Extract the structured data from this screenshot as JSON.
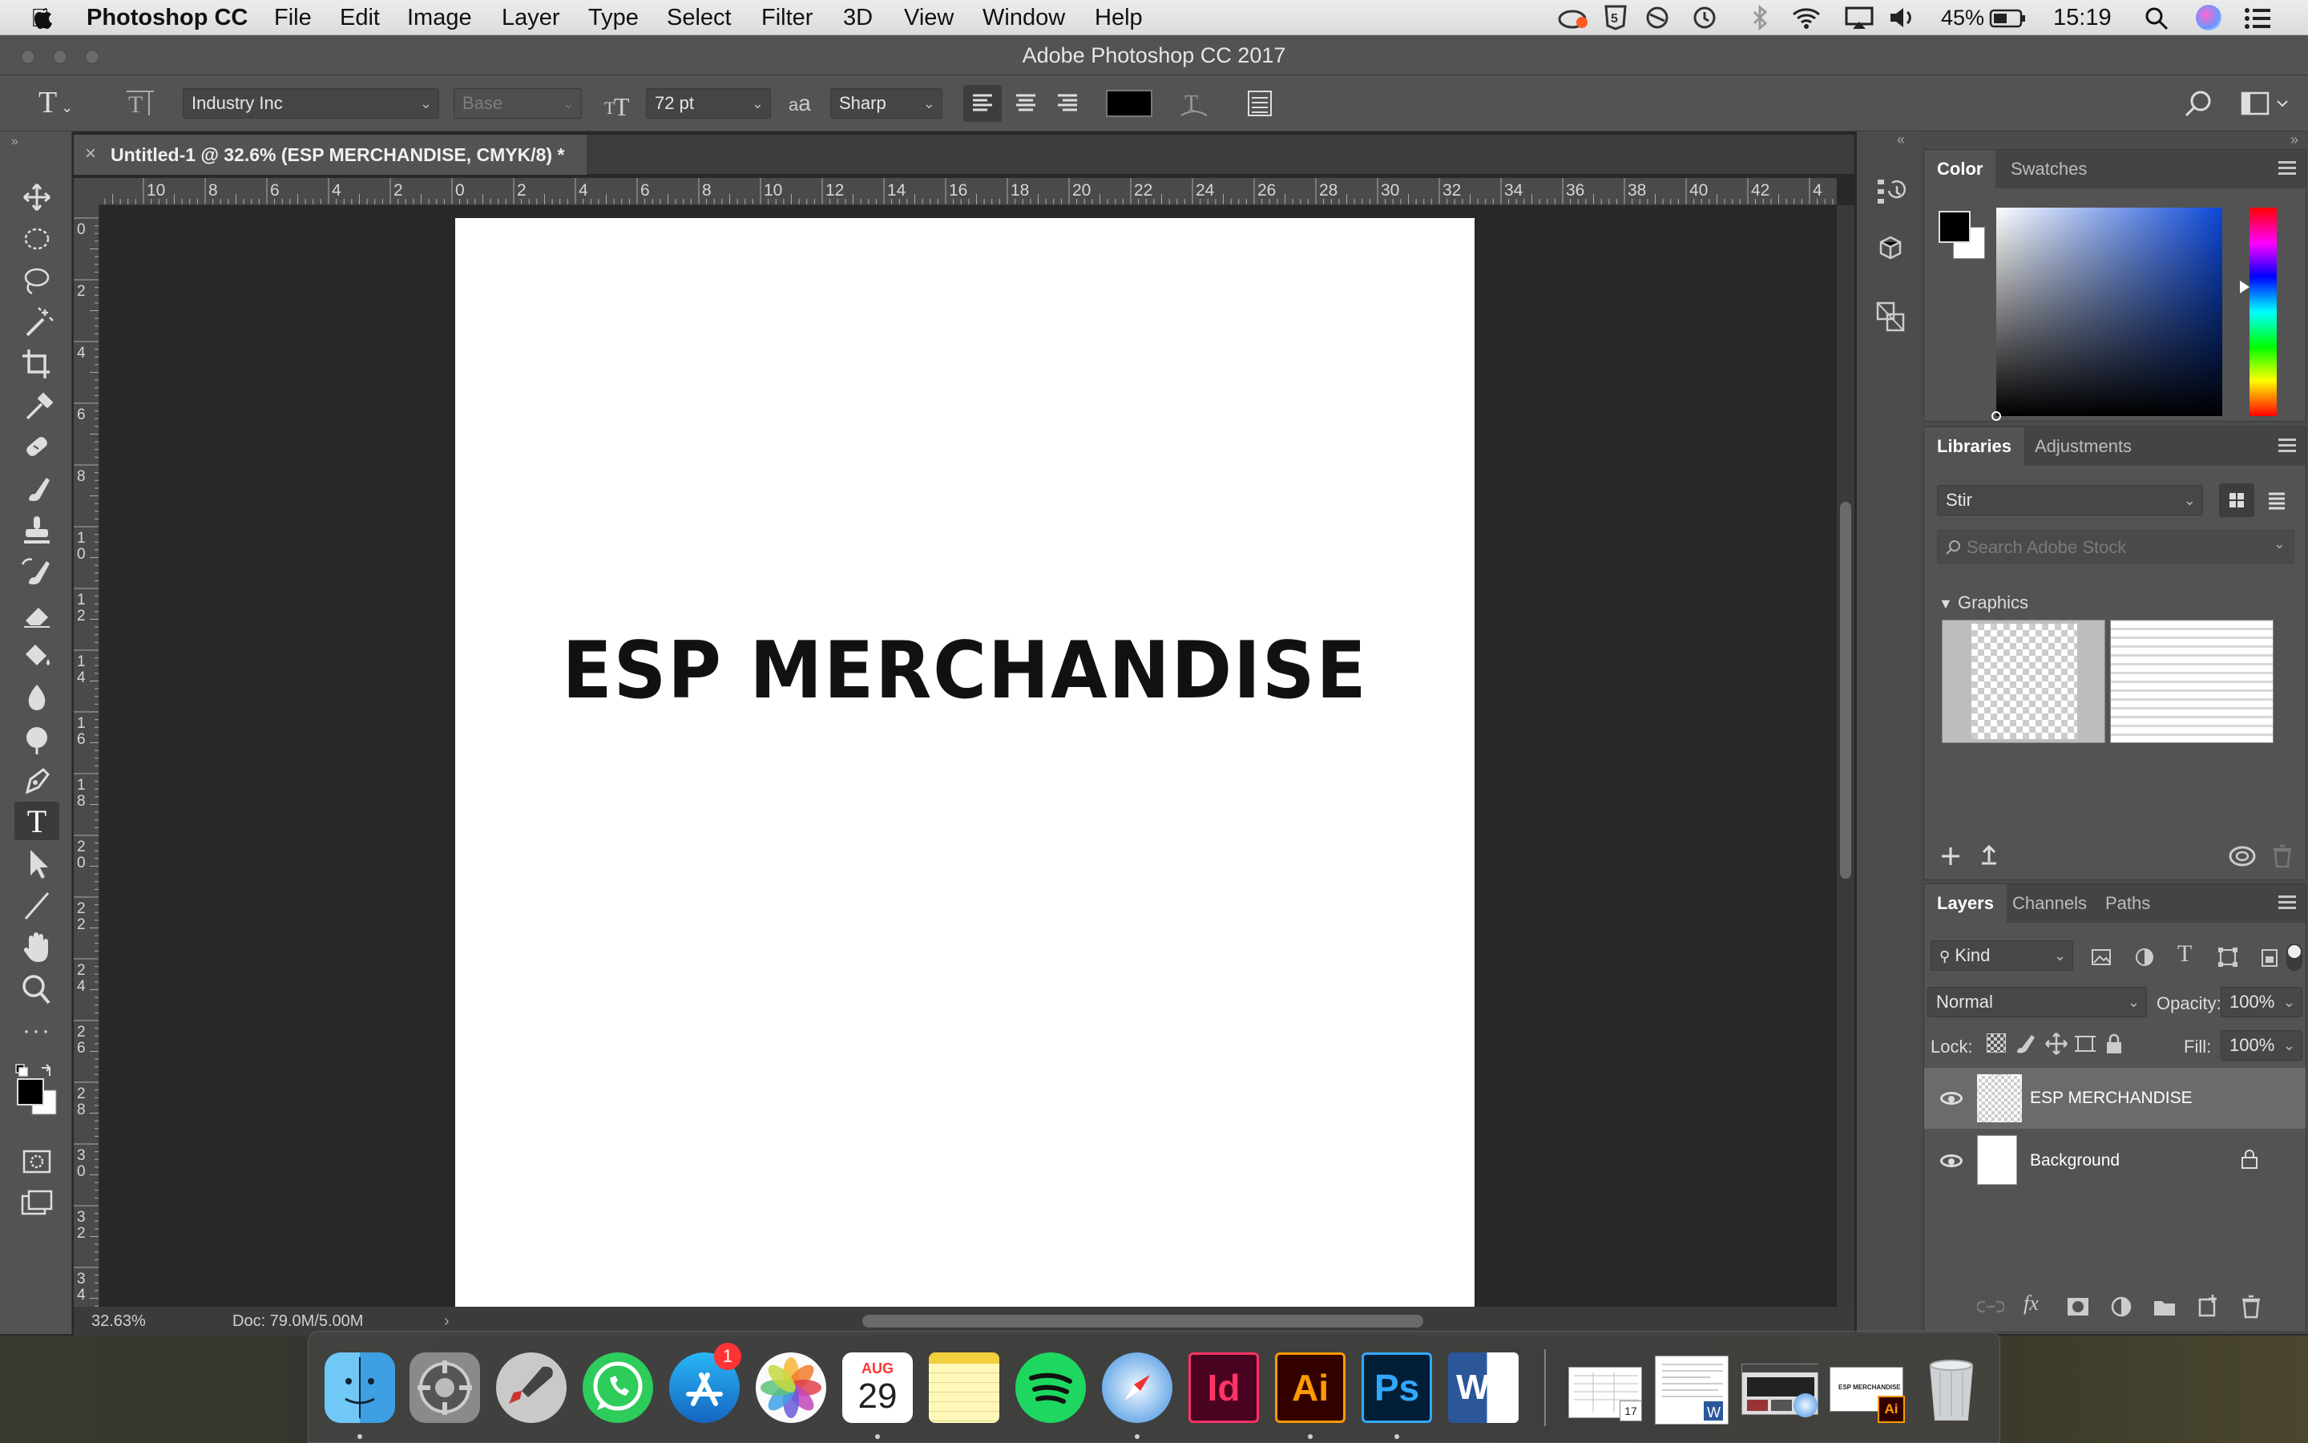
{
  "menubar": {
    "apple": "",
    "app": "Photoshop CC",
    "items": [
      "File",
      "Edit",
      "Image",
      "Layer",
      "Type",
      "Select",
      "Filter",
      "3D",
      "View",
      "Window",
      "Help"
    ],
    "battery": "45%",
    "time": "15:19"
  },
  "window": {
    "title": "Adobe Photoshop CC 2017"
  },
  "options": {
    "font_family": "Industry Inc",
    "font_style": "Base",
    "font_size": "72 pt",
    "aa_label": "a a",
    "antialias": "Sharp",
    "text_color": "#000000"
  },
  "document": {
    "tab_title": "Untitled-1 @ 32.6% (ESP MERCHANDISE, CMYK/8) *",
    "text": "ESP MERCHANDISE",
    "zoom": "32.63%",
    "doc_size": "Doc: 79.0M/5.00M"
  },
  "rulers": {
    "h": [
      "2",
      "10",
      "8",
      "6",
      "4",
      "2",
      "0",
      "2",
      "4",
      "6",
      "8",
      "10",
      "12",
      "14",
      "16",
      "18",
      "20",
      "22",
      "24",
      "26",
      "28",
      "30",
      "32",
      "34",
      "36",
      "38",
      "40",
      "42",
      "4"
    ],
    "v": [
      "0",
      "2",
      "4",
      "6",
      "8",
      "1 0",
      "1 2",
      "1 4",
      "1 6",
      "1 8",
      "2 0",
      "2 2",
      "2 4",
      "2 6",
      "2 8",
      "3 0",
      "3 2",
      "3 4"
    ]
  },
  "color_panel": {
    "tabs": [
      "Color",
      "Swatches"
    ],
    "hue_pos": 0.38
  },
  "libraries": {
    "tabs": [
      "Libraries",
      "Adjustments"
    ],
    "library": "Stir",
    "search_placeholder": "Search Adobe Stock",
    "section": "Graphics"
  },
  "layers": {
    "tabs": [
      "Layers",
      "Channels",
      "Paths"
    ],
    "filter": "Kind",
    "blend": "Normal",
    "opacity_label": "Opacity:",
    "opacity": "100%",
    "lock_label": "Lock:",
    "fill_label": "Fill:",
    "fill": "100%",
    "items": [
      {
        "name": "ESP MERCHANDISE"
      },
      {
        "name": "Background"
      }
    ]
  },
  "dock": {
    "calendar_month": "AUG",
    "calendar_day": "29",
    "appstore_badge": "1",
    "indesign": "Id",
    "illustrator": "Ai",
    "photoshop": "Ps",
    "word": "W",
    "thumb_badge": "17",
    "thumb_text": "ESP MERCHANDISE"
  },
  "colors": {
    "accent": "#1473e6",
    "ps_blue": "#31a8ff",
    "ai_orange": "#ff9a00",
    "id_pink": "#ff3366"
  }
}
